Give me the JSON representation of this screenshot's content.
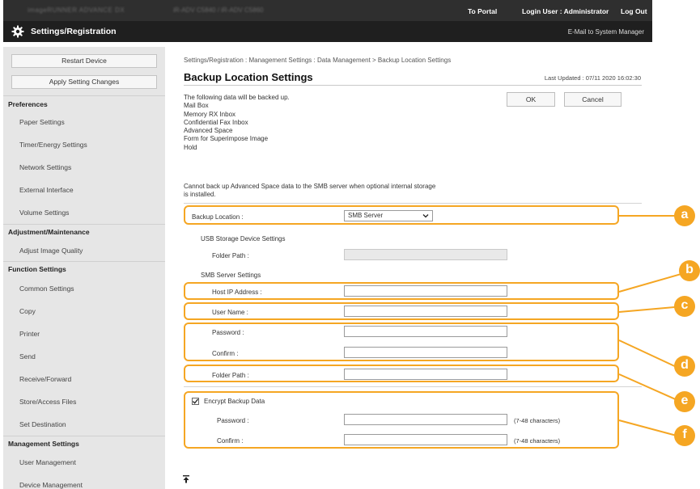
{
  "header": {
    "device_name": "imageRUNNER ADVANCE DX",
    "device_model": "iR-ADV C5840 / iR-ADV C5860",
    "portal_link": "To Portal",
    "login_user": "Login User : Administrator",
    "logout_link": "Log Out",
    "page_heading": "Settings/Registration",
    "mail_link": "E-Mail to System Manager"
  },
  "sidebar": {
    "restart_button": "Restart Device",
    "apply_button": "Apply Setting Changes",
    "sections": [
      {
        "title": "Preferences",
        "items": [
          "Paper Settings",
          "Timer/Energy Settings",
          "Network Settings",
          "External Interface",
          "Volume Settings"
        ]
      },
      {
        "title": "Adjustment/Maintenance",
        "items": [
          "Adjust Image Quality"
        ]
      },
      {
        "title": "Function Settings",
        "items": [
          "Common Settings",
          "Copy",
          "Printer",
          "Send",
          "Receive/Forward",
          "Store/Access Files",
          "Set Destination"
        ]
      },
      {
        "title": "Management Settings",
        "items": [
          "User Management",
          "Device Management"
        ]
      }
    ]
  },
  "main": {
    "breadcrumb": "Settings/Registration : Management Settings : Data Management > Backup Location Settings",
    "title": "Backup Location Settings",
    "last_updated": "Last Updated : 07/11 2020 16:02:30",
    "ok_button": "OK",
    "cancel_button": "Cancel",
    "info_lines": [
      "The following data will be backed up.",
      "Mail Box",
      "Memory RX Inbox",
      "Confidential Fax Inbox",
      "Advanced Space",
      "Form for Superimpose Image",
      "Hold"
    ],
    "warning_lines": [
      "Cannot back up Advanced Space data to the SMB server when optional internal storage",
      "is installed."
    ],
    "backup_location_label": "Backup Location :",
    "backup_location_value": "SMB Server",
    "usb_heading": "USB Storage Device Settings",
    "usb_folder_path_label": "Folder Path :",
    "smb_heading": "SMB Server Settings",
    "host_label": "Host IP Address :",
    "user_label": "User Name :",
    "password_label": "Password :",
    "confirm_label": "Confirm :",
    "folder_path_label": "Folder Path :",
    "encrypt_label": "Encrypt Backup Data",
    "encrypt_checked": true,
    "enc_password_label": "Password :",
    "enc_confirm_label": "Confirm :",
    "char_hint_1": "(7-48 characters)",
    "char_hint_2": "(7-48 characters)"
  },
  "callouts": [
    "a",
    "b",
    "c",
    "d",
    "e",
    "f"
  ],
  "colors": {
    "callout": "#f5a623",
    "topbar": "#2f2f2f",
    "titlebar": "#1f1f1f",
    "sidebar": "#e6e6e6"
  }
}
